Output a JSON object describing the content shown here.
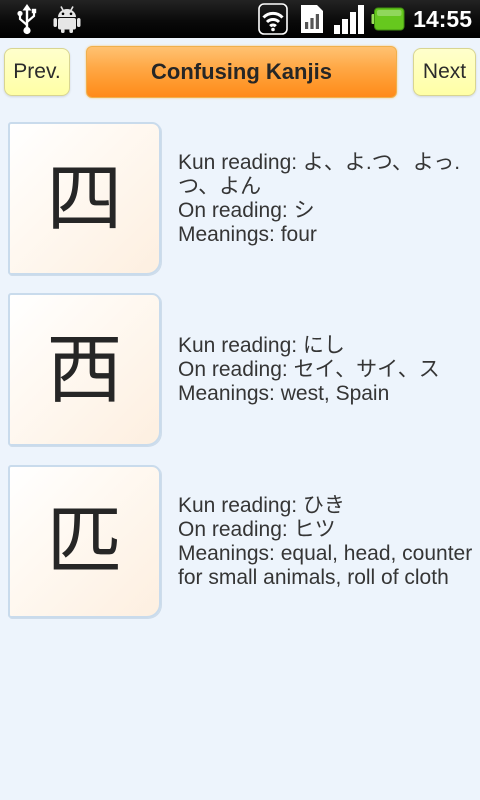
{
  "status_bar": {
    "time": "14:55",
    "icons": [
      "usb-icon",
      "android-debug-icon",
      "wifi-icon",
      "sim-card-icon",
      "signal-strength-icon",
      "battery-icon"
    ]
  },
  "header": {
    "prev_label": "Prev.",
    "title": "Confusing Kanjis",
    "next_label": "Next"
  },
  "kanjis": [
    {
      "character": "四",
      "kun_reading": "Kun reading: よ、よ.つ、よっ.つ、よん",
      "on_reading": "On reading: シ",
      "meanings": "Meanings: four"
    },
    {
      "character": "西",
      "kun_reading": "Kun reading: にし",
      "on_reading": "On reading: セイ、サイ、ス",
      "meanings": "Meanings: west, Spain"
    },
    {
      "character": "匹",
      "kun_reading": "Kun reading: ひき",
      "on_reading": "On reading: ヒツ",
      "meanings": "Meanings: equal, head, counter for small animals, roll of cloth"
    }
  ],
  "colors": {
    "background": "#edf4fc",
    "nav_button": "#ffffa6",
    "title_bar": "#ff9a2e",
    "text": "#333333",
    "battery": "#66c81e",
    "status_bar": "#000000"
  }
}
